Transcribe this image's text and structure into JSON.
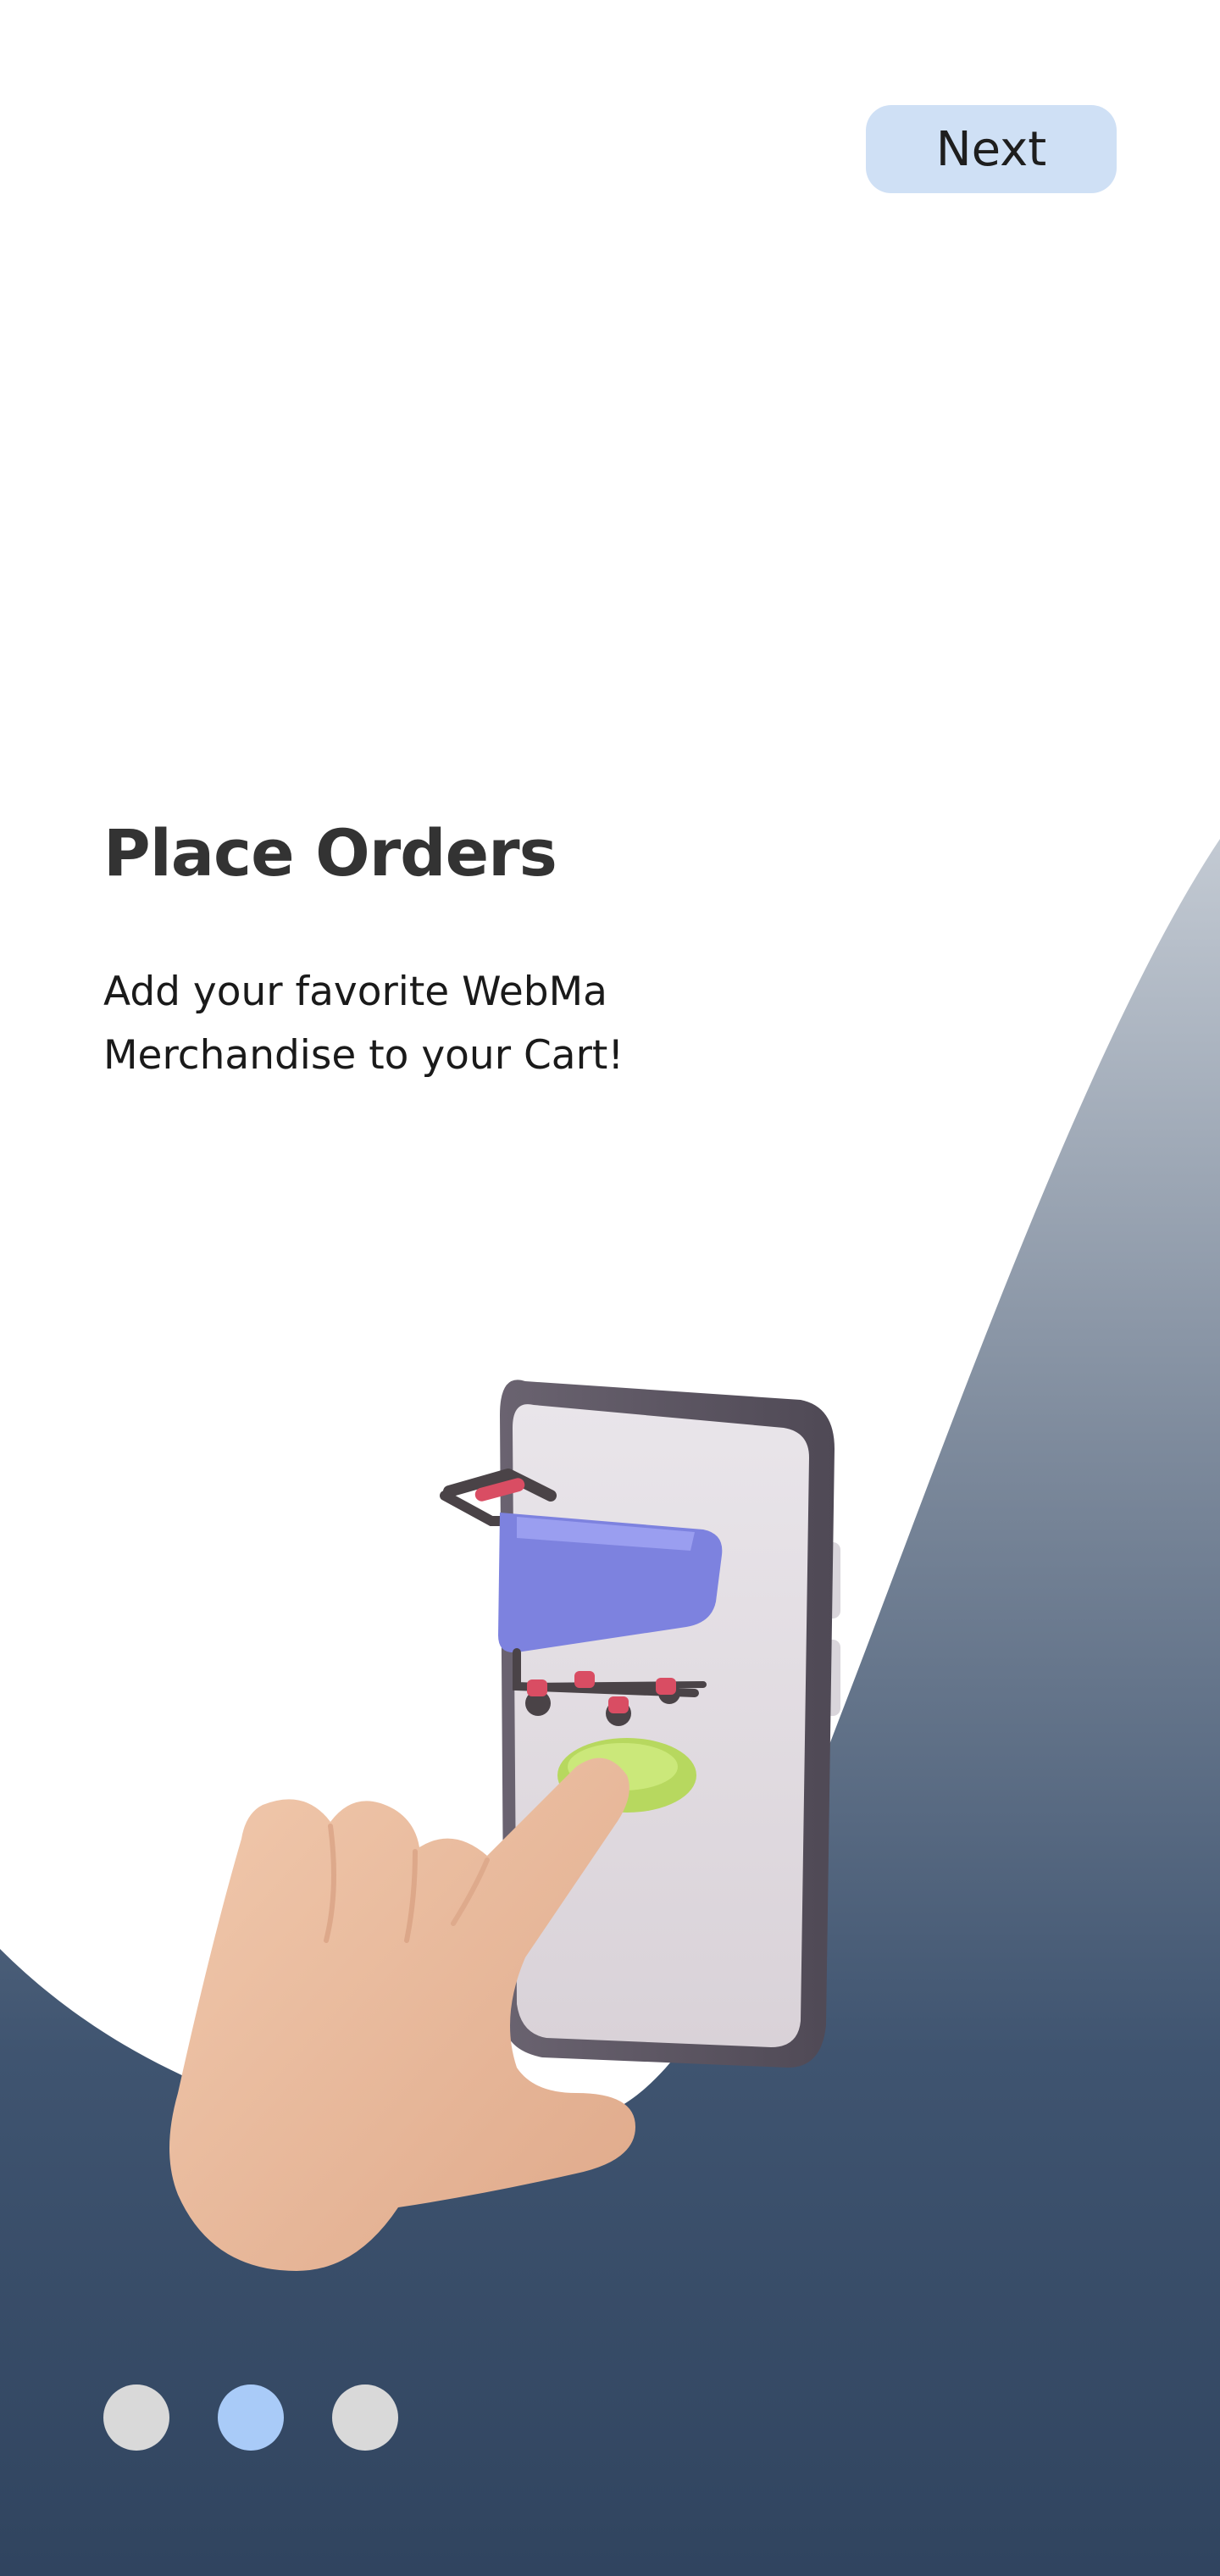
{
  "header": {
    "next_label": "Next"
  },
  "onboarding": {
    "title": "Place Orders",
    "subtitle": "Add your favorite WebMa Merchandise to your Cart!"
  },
  "illustration": {
    "icon": "hand-tapping-phone-cart-icon"
  },
  "pager": {
    "total": 3,
    "active_index": 1
  },
  "colors": {
    "next_button_bg": "#cfe0f5",
    "title_text": "#333333",
    "wave_top": "#b9c1cb",
    "wave_bottom": "#324660",
    "dot_inactive": "#d9d9d9",
    "dot_active": "#a9cbf8"
  }
}
